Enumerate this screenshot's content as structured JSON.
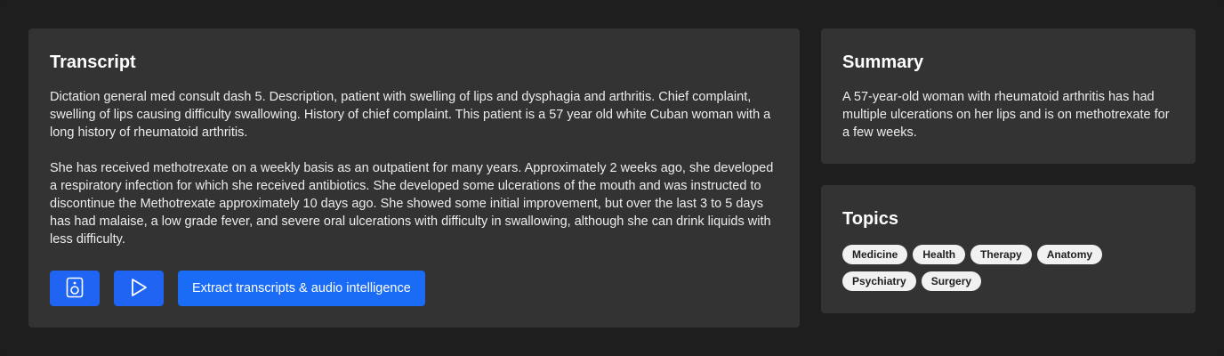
{
  "transcript": {
    "heading": "Transcript",
    "paragraphs": [
      "Dictation general med consult dash 5. Description, patient with swelling of lips and dysphagia and arthritis. Chief complaint, swelling of lips causing difficulty swallowing. History of chief complaint. This patient is a 57 year old white Cuban woman with a long history of rheumatoid arthritis.",
      "She has received methotrexate on a weekly basis as an outpatient for many years. Approximately 2 weeks ago, she developed a respiratory infection for which she received antibiotics. She developed some ulcerations of the mouth and was instructed to discontinue the Methotrexate approximately 10 days ago. She showed some initial improvement, but over the last 3 to 5 days has had malaise, a low grade fever, and severe oral ulcerations with difficulty in swallowing, although she can drink liquids with less difficulty."
    ],
    "actions": {
      "speaker_icon": "speaker-icon",
      "play_icon": "play-icon",
      "extract_label": "Extract transcripts & audio intelligence"
    }
  },
  "summary": {
    "heading": "Summary",
    "text": "A 57-year-old woman with rheumatoid arthritis has had multiple ulcerations on her lips and is on methotrexate for a few weeks."
  },
  "topics": {
    "heading": "Topics",
    "items": [
      "Medicine",
      "Health",
      "Therapy",
      "Anatomy",
      "Psychiatry",
      "Surgery"
    ]
  },
  "colors": {
    "background": "#1e1e1e",
    "card": "#333333",
    "accent": "#1a6cf6",
    "chip": "#f1f1f1"
  }
}
